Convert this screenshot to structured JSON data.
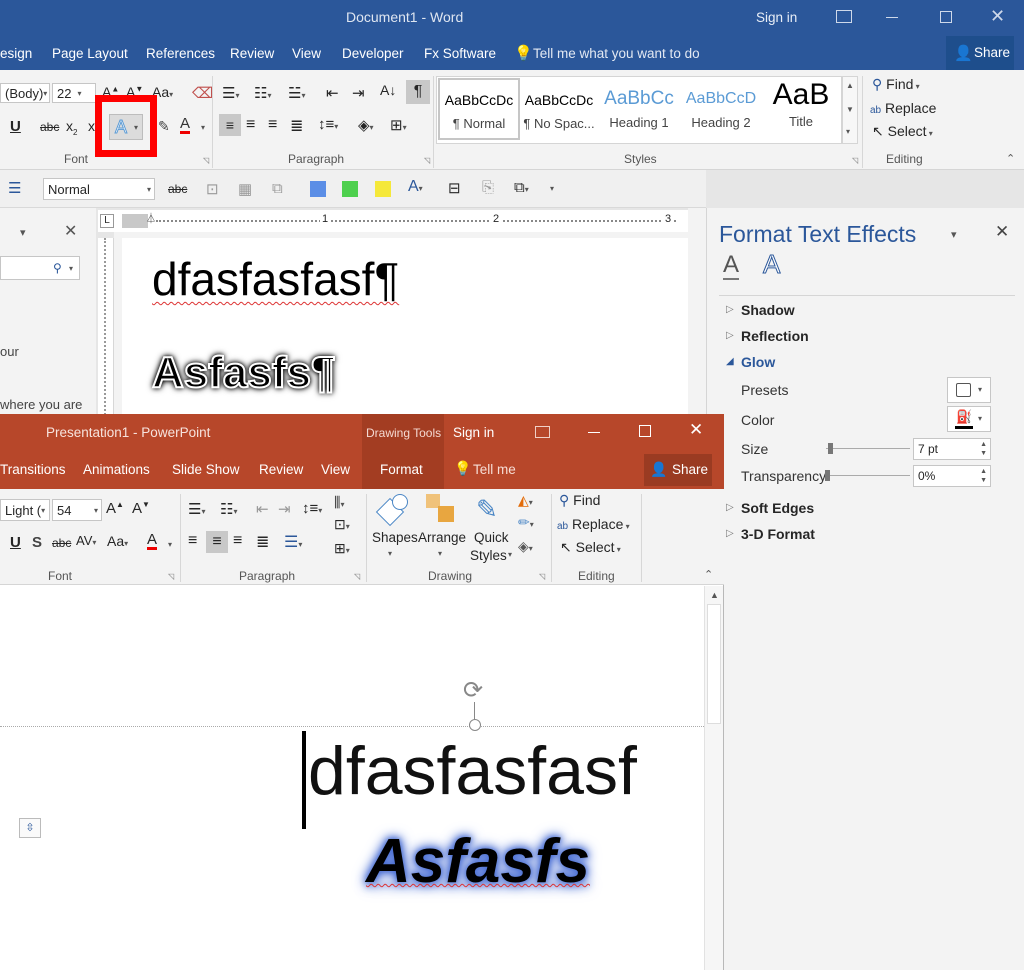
{
  "word": {
    "window_title": "Document1 - Word",
    "sign_in": "Sign in",
    "share": "Share",
    "tabs": [
      "esign",
      "Page Layout",
      "References",
      "Review",
      "View",
      "Developer",
      "Fx Software"
    ],
    "tell_me": "Tell me what you want to do",
    "font_name": "(Body)",
    "font_size": "22",
    "group_font": "Font",
    "group_paragraph": "Paragraph",
    "group_styles": "Styles",
    "group_editing": "Editing",
    "styles": [
      {
        "preview": "AaBbCcDc",
        "name": "¶ Normal"
      },
      {
        "preview": "AaBbCcDc",
        "name": "¶ No Spac..."
      },
      {
        "preview": "AaBbCc",
        "name": "Heading 1"
      },
      {
        "preview": "AaBbCcD",
        "name": "Heading 2"
      },
      {
        "preview": "AaB",
        "name": "Title"
      }
    ],
    "find": "Find",
    "replace": "Replace",
    "select": "Select",
    "style_box": "Normal",
    "nav_text_1": "our",
    "nav_text_2": "where you are",
    "ruler_nums": [
      "1",
      "2",
      "3"
    ],
    "doc_line1": "dfasfasfasf¶",
    "doc_line2": "Asfasfs¶",
    "colors": {
      "accent": "#2b579a",
      "highlight_box": "#ff0000"
    }
  },
  "pane": {
    "title": "Format Text Effects",
    "sections": [
      "Shadow",
      "Reflection",
      "Glow",
      "Soft Edges",
      "3-D Format"
    ],
    "presets": "Presets",
    "color": "Color",
    "size": "Size",
    "size_value": "7 pt",
    "transparency": "Transparency",
    "transparency_value": "0%"
  },
  "ppt": {
    "window_title": "Presentation1 - PowerPoint",
    "drawing_tools": "Drawing Tools",
    "sign_in": "Sign in",
    "share": "Share",
    "tabs": [
      "Transitions",
      "Animations",
      "Slide Show",
      "Review",
      "View"
    ],
    "format_tab": "Format",
    "tell_me": "Tell me",
    "font_name": "Light (",
    "font_size": "54",
    "group_font": "Font",
    "group_paragraph": "Paragraph",
    "group_drawing": "Drawing",
    "group_editing": "Editing",
    "shapes": "Shapes",
    "arrange": "Arrange",
    "quick": "Quick",
    "styles": "Styles",
    "find": "Find",
    "replace": "Replace",
    "select": "Select",
    "slide_line1": "dfasfasfasf",
    "slide_line2": "Asfasfs",
    "colors": {
      "accent": "#b7472a"
    }
  }
}
